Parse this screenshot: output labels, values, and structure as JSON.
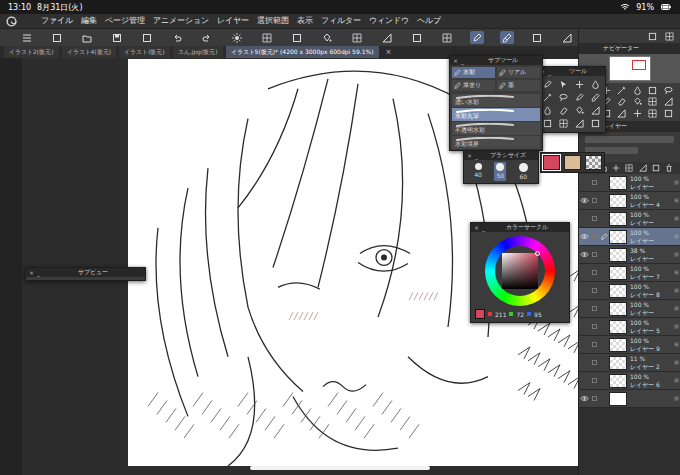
{
  "status_bar": {
    "time": "13:10",
    "date": "8月31日(火)",
    "battery": "91%"
  },
  "menu": [
    "ファイル",
    "編集",
    "ページ管理",
    "アニメーション",
    "レイヤー",
    "選択範囲",
    "表示",
    "フィルター",
    "ウィンドウ",
    "ヘルプ"
  ],
  "toolbar": [
    {
      "selected": false
    },
    {
      "selected": false
    },
    {
      "selected": false
    },
    {
      "selected": false
    },
    {
      "selected": false
    },
    {
      "selected": false
    },
    {
      "selected": false
    },
    {
      "selected": false
    },
    {
      "selected": false
    },
    {
      "selected": false
    },
    {
      "selected": false
    },
    {
      "selected": false
    },
    {
      "selected": false
    },
    {
      "selected": false
    },
    {
      "selected": false
    },
    {
      "selected": true
    },
    {
      "selected": true
    },
    {
      "selected": false
    },
    {
      "selected": false
    }
  ],
  "tabs": [
    {
      "label": "イラスト2(復元)",
      "selected": false
    },
    {
      "label": "イラスト4(復元)",
      "selected": false
    },
    {
      "label": "イラスト(復元)",
      "selected": false
    },
    {
      "label": "スん.jpg(復元)",
      "selected": false
    },
    {
      "label": "イラスト5(復元)* (4200 x 3000px 600dpi 59.1%)",
      "selected": true
    }
  ],
  "tab_close": "×",
  "window_controls": {
    "close": "×",
    "minimize": "_"
  },
  "navigator": {
    "title": "ナビゲーター"
  },
  "layers": {
    "title": "レイヤー",
    "items": [
      {
        "kind": "layer",
        "opacity": "100 %",
        "name": "レイヤー",
        "visible": false,
        "selected": false
      },
      {
        "kind": "layer",
        "opacity": "100 %",
        "name": "レイヤー 4",
        "visible": true,
        "selected": false
      },
      {
        "kind": "layer",
        "opacity": "100 %",
        "name": "レイヤー",
        "visible": false,
        "selected": false
      },
      {
        "kind": "layer",
        "opacity": "100 %",
        "name": "レイヤー",
        "visible": true,
        "selected": true
      },
      {
        "kind": "layer",
        "opacity": "38 %",
        "name": "レイヤー",
        "visible": true,
        "selected": false
      },
      {
        "kind": "layer",
        "opacity": "100 %",
        "name": "レイヤー 7",
        "visible": false,
        "selected": false
      },
      {
        "kind": "layer",
        "opacity": "100 %",
        "name": "レイヤー 8",
        "visible": false,
        "selected": false
      },
      {
        "kind": "layer",
        "opacity": "100 %",
        "name": "レイヤー",
        "visible": false,
        "selected": false
      },
      {
        "kind": "layer",
        "opacity": "100 %",
        "name": "レイヤー 5",
        "visible": false,
        "selected": false
      },
      {
        "kind": "layer",
        "opacity": "100 %",
        "name": "レイヤー 9",
        "visible": false,
        "selected": false
      },
      {
        "kind": "layer",
        "opacity": "11 %",
        "name": "レイヤー 2",
        "visible": false,
        "selected": false
      },
      {
        "kind": "layer",
        "opacity": "100 %",
        "name": "レイヤー 6",
        "visible": false,
        "selected": false
      },
      {
        "kind": "paper",
        "visible": true,
        "selected": false
      }
    ]
  },
  "sub_tool": {
    "title": "サブツール",
    "groups": [
      {
        "label": "水彩",
        "selected": true
      },
      {
        "label": "リアル",
        "selected": false
      },
      {
        "label": "厚塗り",
        "selected": false
      },
      {
        "label": "墨",
        "selected": false
      }
    ],
    "brushes": [
      {
        "label": "濃い水彩",
        "selected": false
      },
      {
        "label": "水彩丸筆",
        "selected": true
      },
      {
        "label": "不透明水彩",
        "selected": false
      },
      {
        "label": "水彩境界",
        "selected": false
      }
    ]
  },
  "tool_window": {
    "title": "ツール"
  },
  "brush_size": {
    "title": "ブラシサイズ",
    "sizes": [
      {
        "label": "40",
        "selected": false
      },
      {
        "label": "50",
        "selected": true
      },
      {
        "label": "60",
        "selected": false
      }
    ]
  },
  "swatches": [
    {
      "color": "#d3485f",
      "selected": true
    },
    {
      "color": "#dcbc98",
      "selected": false
    },
    {
      "color": "transparent",
      "selected": false
    }
  ],
  "color_circle": {
    "title": "カラーサークル",
    "main_color": "#d3485f",
    "values": [
      "211",
      "72",
      "95"
    ]
  },
  "sub_view": {
    "title": "サブビュー"
  }
}
